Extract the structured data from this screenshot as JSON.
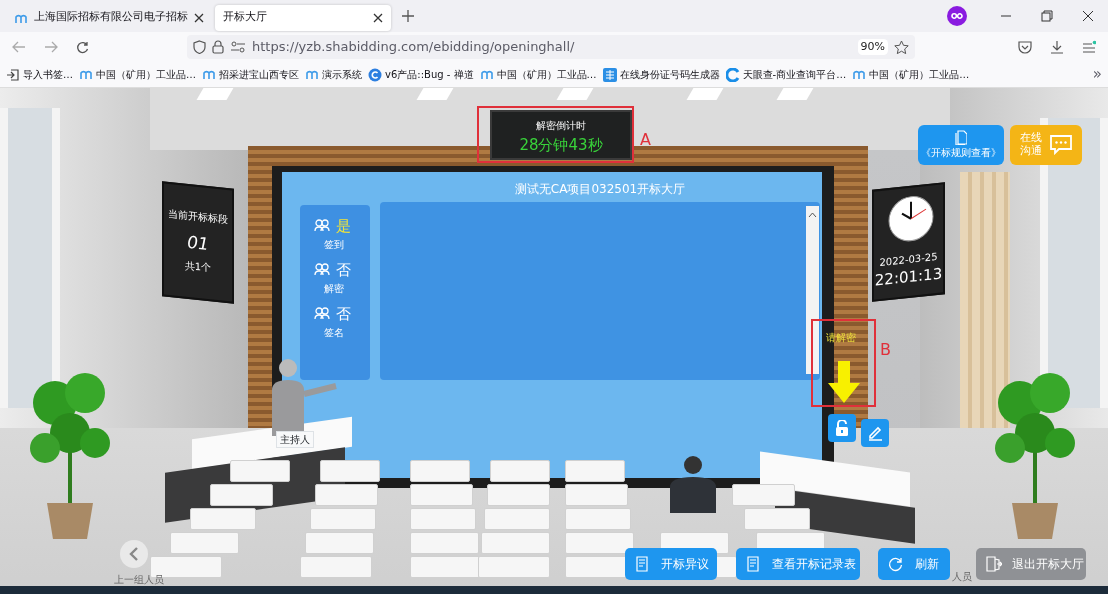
{
  "browser": {
    "tabs": [
      {
        "title": "上海国际招标有限公司电子招标",
        "selected": false
      },
      {
        "title": "开标大厅",
        "selected": true
      }
    ],
    "url": "https://yzb.shabidding.com/ebidding/openinghall/",
    "zoom": "90%",
    "bookmarks": [
      {
        "label": "导入书签…",
        "kind": "import"
      },
      {
        "label": "中国（矿用）工业品…",
        "kind": "site"
      },
      {
        "label": "招采进宝山西专区",
        "kind": "site"
      },
      {
        "label": "演示系统",
        "kind": "site"
      },
      {
        "label": "v6产品::Bug - 禅道",
        "kind": "bug"
      },
      {
        "label": "中国（矿用）工业品…",
        "kind": "site"
      },
      {
        "label": "在线身份证号码生成器",
        "kind": "lookup"
      },
      {
        "label": "天眼查-商业查询平台…",
        "kind": "eye"
      },
      {
        "label": "中国（矿用）工业品…",
        "kind": "site"
      }
    ],
    "overflow": "»"
  },
  "hall": {
    "countdown": {
      "title": "解密倒计时",
      "value": "28分钟43秒"
    },
    "markers": [
      "A",
      "B"
    ],
    "title": "测试无CA项目032501开标大厅",
    "steps": [
      {
        "value": "是",
        "label": "签到",
        "done": true
      },
      {
        "value": "否",
        "label": "解密",
        "done": false
      },
      {
        "value": "否",
        "label": "签名",
        "done": false
      }
    ],
    "section": {
      "title": "当前开标标段",
      "number": "01",
      "total": "共1个"
    },
    "clock": {
      "date": "2022-03-25",
      "time": "22:01:13"
    },
    "rules_button": "《开标规则查看》",
    "chat_button": "在线沟通",
    "hint": "请解密",
    "host_label": "主持人",
    "prev_group": "上一组人员",
    "next_group": "人员",
    "actions": [
      {
        "label": "开标异议",
        "kind": "doc"
      },
      {
        "label": "查看开标记录表",
        "kind": "doc"
      },
      {
        "label": "刷新",
        "kind": "refresh"
      },
      {
        "label": "退出开标大厅",
        "kind": "exit"
      }
    ]
  }
}
